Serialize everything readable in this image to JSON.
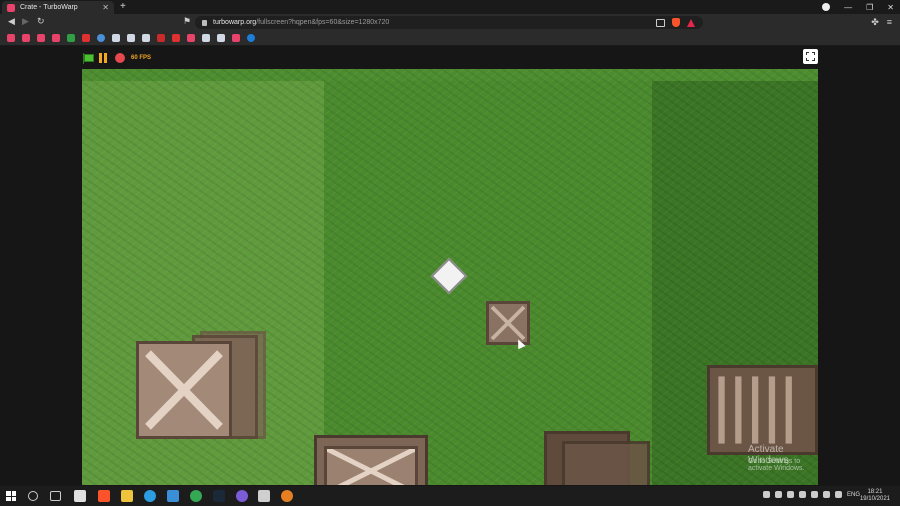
{
  "browser": {
    "tab_title": "Crate - TurboWarp",
    "url_host": "turbowarp.org",
    "url_path": "/fullscreen?hqpen&fps=60&size=1280x720"
  },
  "stage_controls": {
    "fps_label": "60 FPS"
  },
  "watermark": {
    "title": "Activate Windows",
    "subtitle": "Go to Settings to activate Windows."
  },
  "taskbar": {
    "language": "ENG",
    "time": "18:21",
    "date": "19/10/2021"
  },
  "colors": {
    "flag_green": "#4cbf32",
    "pause_orange": "#f5a623",
    "stop_red": "#e5484d",
    "crate_brown": "#7d6656"
  }
}
